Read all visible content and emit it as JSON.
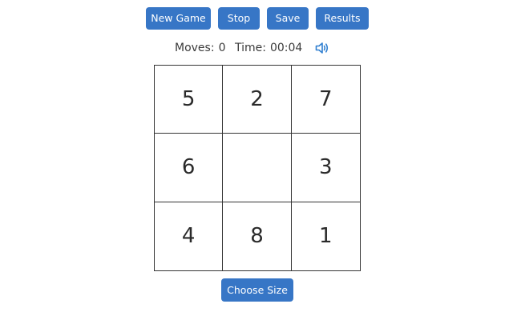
{
  "toolbar": {
    "new_game_label": "New Game",
    "stop_label": "Stop",
    "save_label": "Save",
    "results_label": "Results"
  },
  "status": {
    "moves_label": "Moves:",
    "moves_value": "0",
    "time_label": "Time:",
    "time_value": "00:04",
    "sound_icon": "speaker-on-icon"
  },
  "board": {
    "size": 3,
    "tiles": [
      "5",
      "2",
      "7",
      "6",
      "",
      "3",
      "4",
      "8",
      "1"
    ]
  },
  "footer": {
    "choose_size_label": "Choose Size"
  },
  "colors": {
    "accent": "#3776c6",
    "sound_icon": "#2f7fd0",
    "grid_line": "#333333",
    "text": "#3a3a3a"
  }
}
